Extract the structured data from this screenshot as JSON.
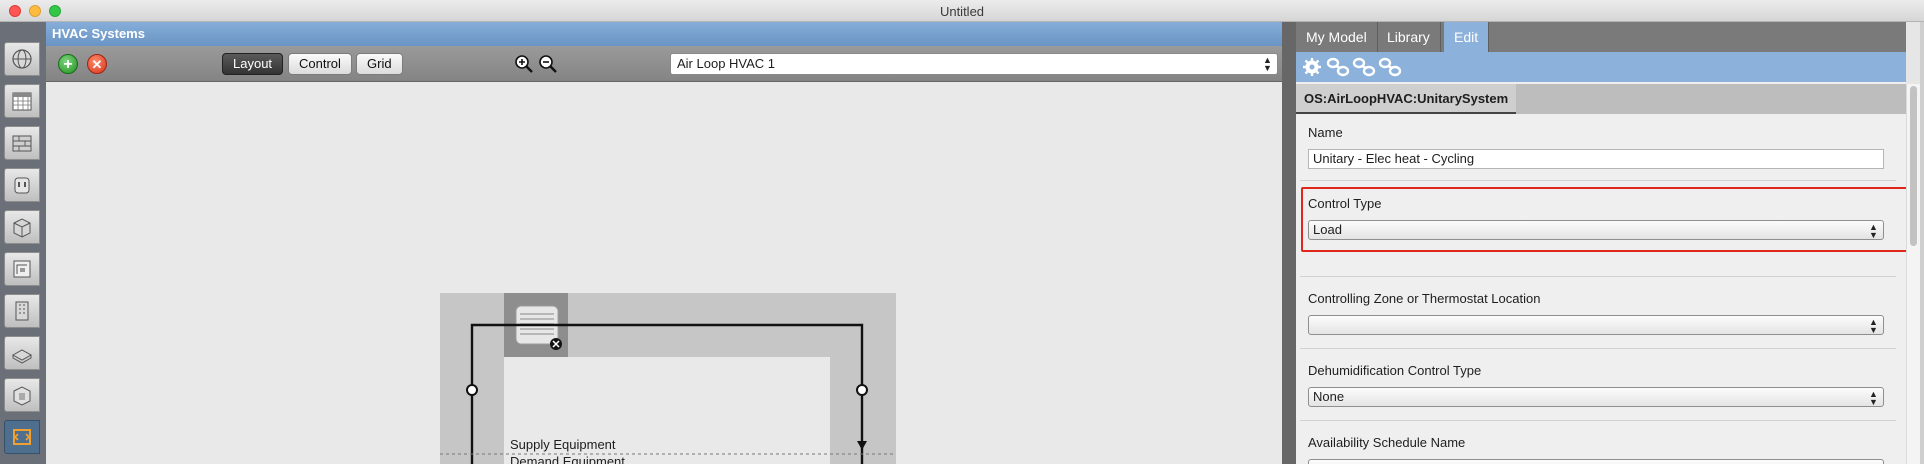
{
  "window": {
    "title": "Untitled"
  },
  "hvac": {
    "header": "HVAC Systems",
    "toolbar": {
      "layout_label": "Layout",
      "control_label": "Control",
      "grid_label": "Grid",
      "loop_selected": "Air Loop HVAC 1"
    },
    "canvas": {
      "supply_label": "Supply Equipment",
      "demand_label": "Demand Equipment"
    }
  },
  "right": {
    "tabs": [
      {
        "label": "My Model"
      },
      {
        "label": "Library"
      },
      {
        "label": "Edit"
      }
    ],
    "object_title": "OS:AirLoopHVAC:UnitarySystem",
    "fields": {
      "name": {
        "label": "Name",
        "value": "Unitary - Elec heat - Cycling"
      },
      "control_type": {
        "label": "Control Type",
        "value": "Load"
      },
      "controlling_zone": {
        "label": "Controlling Zone or Thermostat Location",
        "value": ""
      },
      "dehumid": {
        "label": "Dehumidification Control Type",
        "value": "None"
      },
      "availability": {
        "label": "Availability Schedule Name",
        "value": ""
      }
    }
  },
  "colors": {
    "accent_blue": "#8cb2dc",
    "highlight_red": "#e1261c",
    "add_green": "#1f8f1f",
    "remove_red": "#d5341a"
  },
  "icons": {
    "rail": [
      "site-globe-icon",
      "schedules-calendar-icon",
      "constructions-wall-icon",
      "loads-plug-icon",
      "space-types-icon",
      "geometry-icon",
      "facility-building-icon",
      "spaces-icon",
      "thermal-zones-icon",
      "hvac-systems-icon"
    ],
    "edit_tools": [
      "gear-icon",
      "link-icon",
      "link-icon",
      "link-icon"
    ]
  }
}
